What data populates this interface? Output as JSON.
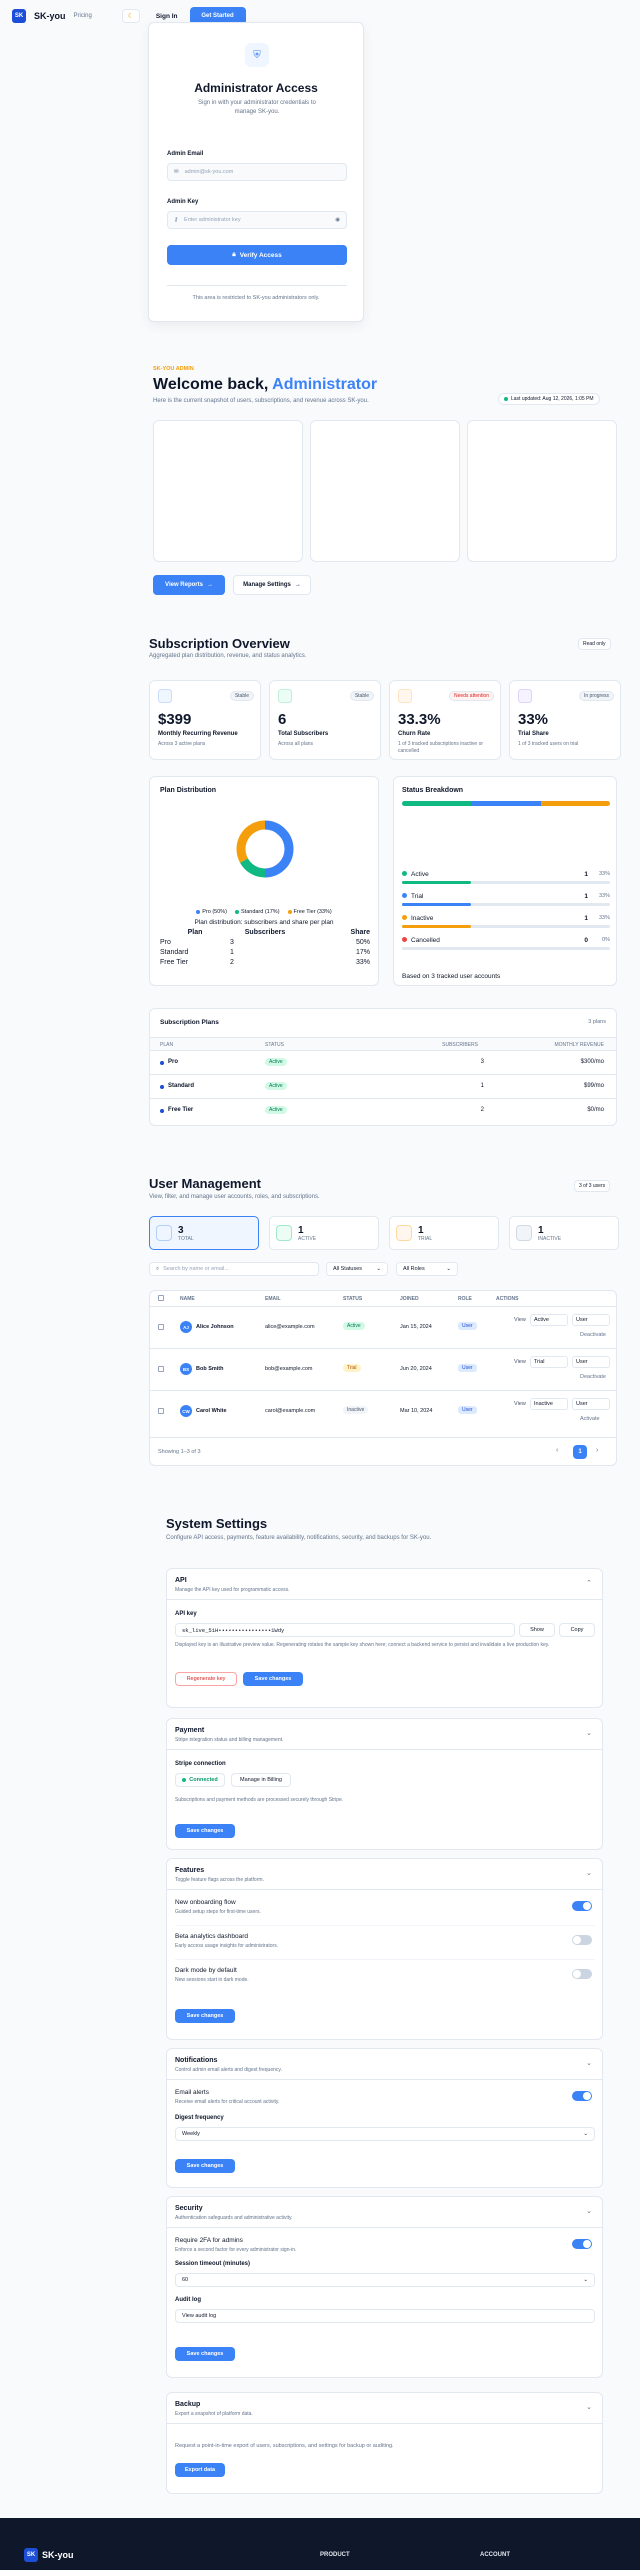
{
  "header": {
    "logo": "SK",
    "brand": "SK-you",
    "pricing": "Pricing",
    "theme_icon": "moon-icon",
    "signin": "Sign In",
    "cta": "Get Started"
  },
  "login": {
    "title": "Administrator Access",
    "subtitle": "Sign in with your administrator credentials to manage SK-you.",
    "email_label": "Admin Email",
    "email_placeholder": "admin@sk-you.com",
    "key_label": "Admin Key",
    "key_placeholder": "Enter administrator key",
    "submit": "Verify Access",
    "note": "This area is restricted to SK-you administrators only."
  },
  "welcome": {
    "eyebrow": "SK-YOU ADMIN",
    "title_a": "Welcome back,",
    "title_b": "Administrator",
    "subtitle": "Here is the current snapshot of users, subscriptions, and revenue across SK-you.",
    "updated": "Last updated: Aug 12, 2026, 1:05 PM",
    "view_reports": "View Reports",
    "manage_settings": "Manage Settings"
  },
  "subs": {
    "title": "Subscription Overview",
    "subtitle": "Aggregated plan distribution, revenue, and status analytics.",
    "badge": "Read only",
    "stats": [
      {
        "value": "$399",
        "label": "Monthly Recurring Revenue",
        "sub": "Across 3 active plans",
        "pill": "Stable"
      },
      {
        "value": "6",
        "label": "Total Subscribers",
        "sub": "Across all plans",
        "pill": "Stable"
      },
      {
        "value": "33.3%",
        "label": "Churn Rate",
        "sub": "1 of 3 tracked subscriptions inactive or cancelled",
        "pill": "Needs attention"
      },
      {
        "value": "33%",
        "label": "Trial Share",
        "sub": "1 of 3 tracked users on trial",
        "pill": "In progress"
      }
    ],
    "dist_title": "Plan Distribution",
    "status_title": "Status Breakdown",
    "legend": [
      "Pro (50%)",
      "Standard (17%)",
      "Free Tier (33%)"
    ],
    "caption": "Plan distribution: subscribers and share per plan",
    "dist_headers": [
      "Plan",
      "Subscribers",
      "Share"
    ],
    "dist_rows": [
      [
        "Pro",
        "3",
        "50%"
      ],
      [
        "Standard",
        "1",
        "17%"
      ],
      [
        "Free Tier",
        "2",
        "33%"
      ]
    ],
    "status_rows": [
      {
        "label": "Active",
        "count": "1",
        "pct": "33%",
        "color": "#10b981"
      },
      {
        "label": "Trial",
        "count": "1",
        "pct": "33%",
        "color": "#3b82f6"
      },
      {
        "label": "Inactive",
        "count": "1",
        "pct": "33%",
        "color": "#f59e0b"
      },
      {
        "label": "Cancelled",
        "count": "0",
        "pct": "0%",
        "color": "#ef4444"
      }
    ],
    "status_note": "Based on 3 tracked user accounts",
    "plans_title": "Subscription Plans",
    "plans_count": "3 plans",
    "plans_headers": [
      "PLAN",
      "STATUS",
      "SUBSCRIBERS",
      "MONTHLY REVENUE"
    ],
    "plans": [
      [
        "Pro",
        "Active",
        "3",
        "$300/mo"
      ],
      [
        "Standard",
        "Active",
        "1",
        "$99/mo"
      ],
      [
        "Free Tier",
        "Active",
        "2",
        "$0/mo"
      ]
    ]
  },
  "chart_data": {
    "type": "pie",
    "categories": [
      "Pro",
      "Standard",
      "Free Tier"
    ],
    "values": [
      50,
      17,
      33
    ],
    "title": "Plan Distribution",
    "colors": [
      "#3b82f6",
      "#10b981",
      "#f59e0b"
    ]
  },
  "users": {
    "title": "User Management",
    "subtitle": "View, filter, and manage user accounts, roles, and subscriptions.",
    "count": "3 of 3 users",
    "tiles": [
      {
        "n": "3",
        "t": "TOTAL"
      },
      {
        "n": "1",
        "t": "ACTIVE"
      },
      {
        "n": "1",
        "t": "TRIAL"
      },
      {
        "n": "1",
        "t": "INACTIVE"
      }
    ],
    "search_placeholder": "Search by name or email...",
    "status_filter": "All Statuses",
    "role_filter": "All Roles",
    "headers": [
      "NAME",
      "EMAIL",
      "STATUS",
      "JOINED",
      "ROLE",
      "ACTIONS"
    ],
    "rows": [
      {
        "initials": "AJ",
        "name": "Alice Johnson",
        "email": "alice@example.com",
        "status": "Active",
        "joined": "Jan 15, 2024",
        "role": "User",
        "sel": "Active",
        "deact": "Deactivate"
      },
      {
        "initials": "BS",
        "name": "Bob Smith",
        "email": "bob@example.com",
        "status": "Trial",
        "joined": "Jun 20, 2024",
        "role": "User",
        "sel": "Trial",
        "deact": "Deactivate"
      },
      {
        "initials": "CW",
        "name": "Carol White",
        "email": "carol@example.com",
        "status": "Inactive",
        "joined": "Mar 10, 2024",
        "role": "User",
        "sel": "Inactive",
        "deact": "Activate"
      }
    ],
    "view": "View",
    "user_sel": "User",
    "showing": "Showing 1–3 of 3",
    "page": "1"
  },
  "settings": {
    "title": "System Settings",
    "subtitle": "Configure API access, payments, feature availability, notifications, security, and backups for SK-you.",
    "api": {
      "title": "API",
      "sub": "Manage the API key used for programmatic access.",
      "key_label": "API key",
      "key": "sk_live_51H••••••••••••••••1Wdy",
      "show": "Show",
      "copy": "Copy",
      "note": "Displayed key is an illustrative preview value. Regenerating rotates the sample key shown here; connect a backend service to persist and invalidate a live production key.",
      "regen": "Regenerate key",
      "save": "Save changes"
    },
    "payment": {
      "title": "Payment",
      "sub": "Stripe integration status and billing management.",
      "label": "Stripe connection",
      "connected": "Connected",
      "billing": "Manage in Billing",
      "note": "Subscriptions and payment methods are processed securely through Stripe.",
      "save": "Save changes"
    },
    "features": {
      "title": "Features",
      "sub": "Toggle feature flags across the platform.",
      "items": [
        {
          "t": "New onboarding flow",
          "s": "Guided setup steps for first-time users."
        },
        {
          "t": "Beta analytics dashboard",
          "s": "Early access usage insights for administrators."
        },
        {
          "t": "Dark mode by default",
          "s": "New sessions start in dark mode."
        }
      ],
      "save": "Save changes"
    },
    "notifications": {
      "title": "Notifications",
      "sub": "Control admin email alerts and digest frequency.",
      "alerts": "Email alerts",
      "alerts_sub": "Receive email alerts for critical account activity.",
      "digest": "Digest frequency",
      "digest_val": "Weekly",
      "save": "Save changes"
    },
    "security": {
      "title": "Security",
      "sub": "Authentication safeguards and administrative activity.",
      "twofa": "Require 2FA for admins",
      "twofa_sub": "Enforce a second factor for every administrator sign-in.",
      "timeout": "Session timeout (minutes)",
      "timeout_val": "60",
      "audit": "Audit log",
      "audit_btn": "View audit log",
      "save": "Save changes"
    },
    "backup": {
      "title": "Backup",
      "sub": "Export a snapshot of platform data.",
      "note": "Request a point-in-time export of users, subscriptions, and settings for backup or auditing.",
      "export": "Export data"
    }
  },
  "footer": {
    "brand": "SK-you",
    "col1": "PRODUCT",
    "col2": "ACCOUNT"
  }
}
